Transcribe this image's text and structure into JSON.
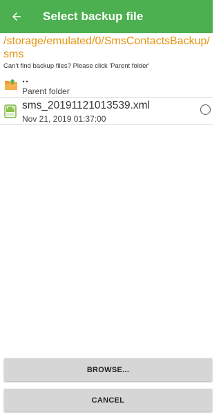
{
  "toolbar": {
    "title": "Select backup file",
    "back_icon": "arrow-left-icon",
    "background": "#4caf50"
  },
  "path": {
    "text": "/storage/emulated/0/SmsContactsBackup/sms",
    "color": "#e39412"
  },
  "hint": "Can't find backup files? Please click 'Parent folder'",
  "items": [
    {
      "name": "..",
      "subtitle": "Parent folder",
      "icon": "folder-up-icon"
    },
    {
      "name": "sms_20191121013539.xml",
      "subtitle": "Nov 21, 2019 01:37:00",
      "icon": "xml-file-icon",
      "selected": false
    }
  ],
  "buttons": {
    "browse": "BROWSE...",
    "cancel": "CANCEL"
  }
}
